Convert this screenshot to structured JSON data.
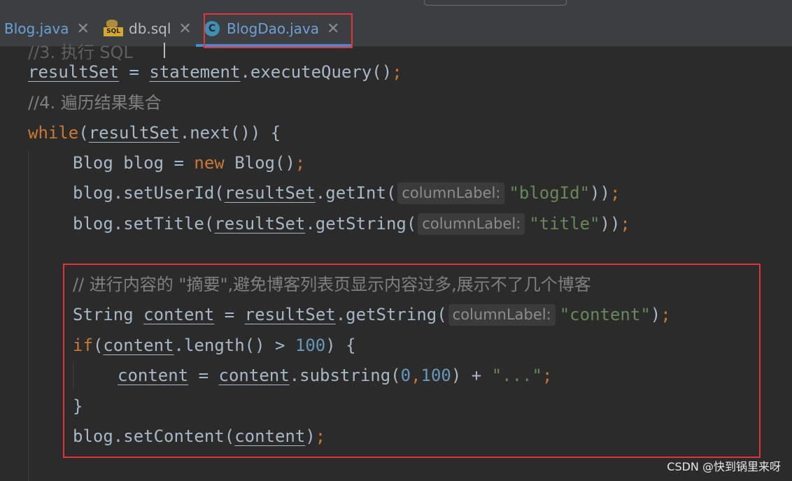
{
  "tabs": [
    {
      "label": "Blog.java",
      "icon": "java-file-icon",
      "active": false
    },
    {
      "label": "db.sql",
      "icon": "sql-file-icon",
      "active": false
    },
    {
      "label": "BlogDao.java",
      "icon": "java-class-icon",
      "active": true
    }
  ],
  "icons": {
    "sql_badge": "SQL",
    "class_badge": "C",
    "close": "✕"
  },
  "code": {
    "partial_line": "//3. 执行 SQL",
    "l1": {
      "v": "resultSet",
      "op": " = ",
      "obj": "statement",
      "call": ".executeQuery()",
      "semi": ";"
    },
    "l2": "//4. 遍历结果集合",
    "l3": {
      "kw": "while",
      "open": "(",
      "v": "resultSet",
      "rest": ".next()) {"
    },
    "l4": {
      "a": "Blog blog = ",
      "kw": "new",
      "b": " Blog()",
      "semi": ";"
    },
    "l5": {
      "a": "blog.setUserId(",
      "v": "resultSet",
      "b": ".getInt(",
      "hint": "columnLabel:",
      "s": "\"blogId\"",
      "c": "))",
      "semi": ";"
    },
    "l6": {
      "a": "blog.setTitle(",
      "v": "resultSet",
      "b": ".getString(",
      "hint": "columnLabel:",
      "s": "\"title\"",
      "c": "))",
      "semi": ";"
    },
    "l7": "// 进行内容的 \"摘要\",避免博客列表页显示内容过多,展示不了几个博客",
    "l8": {
      "a": "String ",
      "v": "content",
      "op": " = ",
      "v2": "resultSet",
      "b": ".getString(",
      "hint": "columnLabel:",
      "s": "\"content\"",
      "c": ")",
      "semi": ";"
    },
    "l9": {
      "kw": "if",
      "open": "(",
      "v": "content",
      "b": ".length() > ",
      "n": "100",
      "c": ") {"
    },
    "l10": {
      "v": "content",
      "op": " = ",
      "v2": "content",
      "b": ".substring(",
      "n1": "0",
      "comma": ",",
      "n2": "100",
      "c": ") + ",
      "s": "\"...\"",
      "semi": ";"
    },
    "l11": "}",
    "l12": {
      "a": "blog.setContent(",
      "v": "content",
      "c": ")",
      "semi": ";"
    }
  },
  "watermark": "CSDN @快到锅里来呀"
}
